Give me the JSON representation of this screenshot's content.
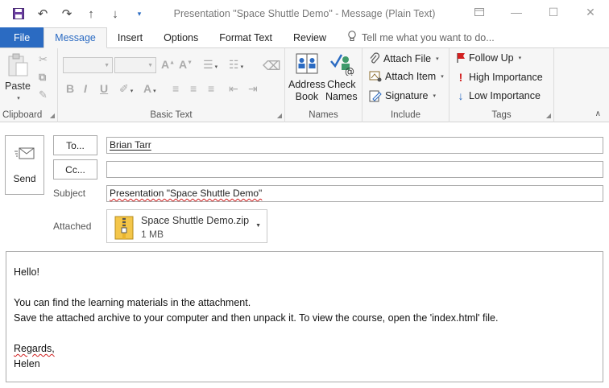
{
  "window": {
    "title": "Presentation \"Space Shuttle Demo\" - Message (Plain Text)"
  },
  "quick_access": {
    "icons": [
      "save-icon",
      "undo-icon",
      "redo-icon",
      "up-arrow-icon",
      "down-arrow-icon",
      "customize-icon"
    ]
  },
  "tabs": {
    "file": "File",
    "message": "Message",
    "insert": "Insert",
    "options": "Options",
    "format_text": "Format Text",
    "review": "Review",
    "tell_me": "Tell me what you want to do..."
  },
  "ribbon": {
    "clipboard": {
      "label": "Clipboard",
      "paste": "Paste"
    },
    "basic_text": {
      "label": "Basic Text"
    },
    "names": {
      "label": "Names",
      "address_book_line1": "Address",
      "address_book_line2": "Book",
      "check_names_line1": "Check",
      "check_names_line2": "Names"
    },
    "include": {
      "label": "Include",
      "attach_file": "Attach File",
      "attach_item": "Attach Item",
      "signature": "Signature"
    },
    "tags": {
      "label": "Tags",
      "follow_up": "Follow Up",
      "high_importance": "High Importance",
      "low_importance": "Low Importance"
    }
  },
  "compose": {
    "send": "Send",
    "to_button": "To...",
    "cc_button": "Cc...",
    "subject_label": "Subject",
    "attached_label": "Attached",
    "to_value": "Brian Tarr",
    "cc_value": "",
    "subject_value": "Presentation \"Space Shuttle Demo\"",
    "attachment": {
      "name": "Space Shuttle Demo.zip",
      "size": "1 MB"
    }
  },
  "message_body": {
    "greeting": "Hello!",
    "line1": "You can find the learning materials in the attachment.",
    "line2": "Save the attached archive to your computer and then unpack it. To view the course, open the 'index.html' file.",
    "closing": "Regards,",
    "signature": "Helen"
  },
  "colors": {
    "accent": "#2b6bc2",
    "high_importance": "#d22020",
    "low_importance": "#2b6bc2",
    "flag": "#d22020"
  }
}
